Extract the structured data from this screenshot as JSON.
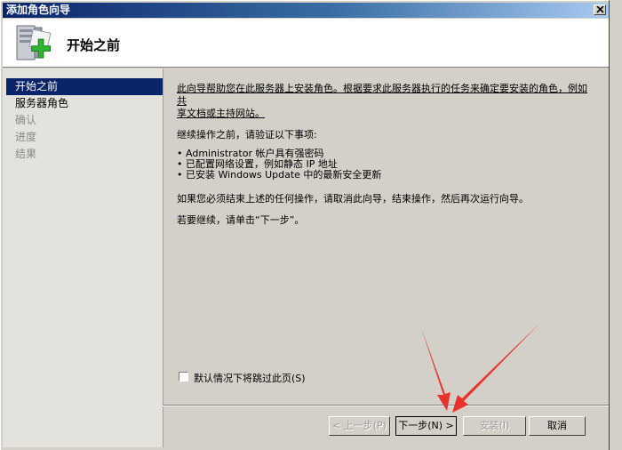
{
  "window": {
    "title": "添加角色向导"
  },
  "header": {
    "title": "开始之前",
    "icon": "server-add-icon"
  },
  "sidebar": {
    "items": [
      {
        "label": "开始之前",
        "state": "active"
      },
      {
        "label": "服务器角色",
        "state": "enabled"
      },
      {
        "label": "确认",
        "state": "disabled"
      },
      {
        "label": "进度",
        "state": "disabled"
      },
      {
        "label": "结果",
        "state": "disabled"
      }
    ]
  },
  "content": {
    "intro_line1": "此向导帮助您在此服务器上安装角色。根据要求此服务器执行的任务来确定要安装的角色，例如共",
    "intro_line2": "享文档或主持网站。",
    "verify_heading": "继续操作之前，请验证以下事项:",
    "bullets": [
      "Administrator 帐户具有强密码",
      "已配置网络设置，例如静态 IP 地址",
      "已安装 Windows Update 中的最新安全更新"
    ],
    "cancel_note": "如果您必须结束上述的任何操作，请取消此向导，结束操作，然后再次运行向导。",
    "continue_note": "若要继续，请单击“下一步”。"
  },
  "skip_checkbox": {
    "label": "默认情况下将跳过此页(S)",
    "checked": false
  },
  "buttons": {
    "back": "< 上一步(P)",
    "next": "下一步(N) >",
    "install": "安装(I)",
    "cancel": "取消"
  },
  "colors": {
    "title_bar": "#0a246a",
    "selection": "#0a246a",
    "annotation_arrow": "#e8322a"
  }
}
